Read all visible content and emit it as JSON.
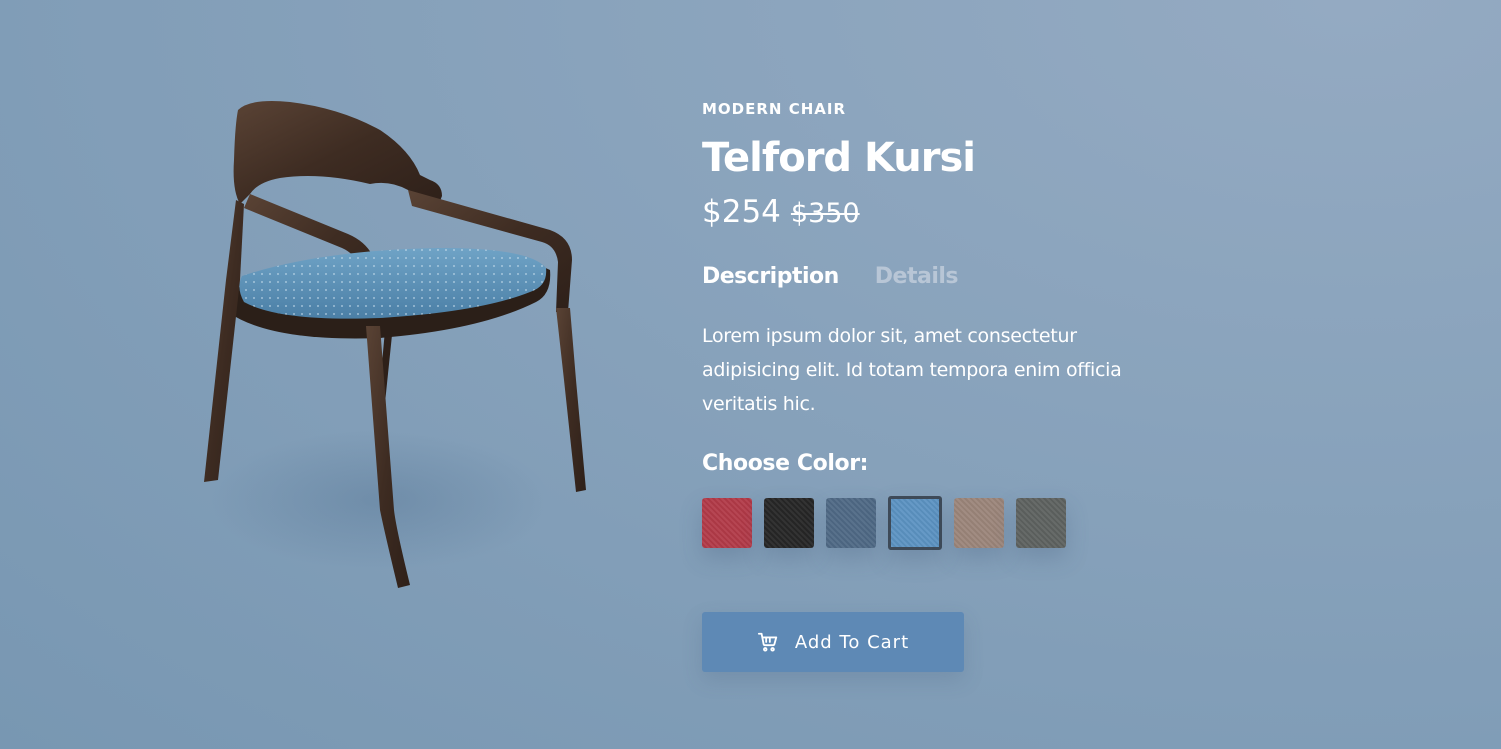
{
  "product": {
    "category": "MODERN CHAIR",
    "name": "Telford Kursi",
    "price_current": "$254",
    "price_old": "$350",
    "image_icon": "chair-image"
  },
  "tabs": [
    {
      "label": "Description",
      "active": true
    },
    {
      "label": "Details",
      "active": false
    }
  ],
  "description": "Lorem ipsum dolor sit, amet consectetur adipisicing elit. Id totam tempora enim officia veritatis hic.",
  "color_picker": {
    "label": "Choose Color:",
    "options": [
      {
        "name": "red",
        "color": "#b23a48"
      },
      {
        "name": "black",
        "color": "#262626"
      },
      {
        "name": "denim",
        "color": "#4f6985"
      },
      {
        "name": "light-blue",
        "color": "#5c93c2",
        "selected": true
      },
      {
        "name": "beige",
        "color": "#9b857a"
      },
      {
        "name": "gray",
        "color": "#5e6260"
      }
    ]
  },
  "cart_button": {
    "label": "Add To Cart",
    "icon": "cart-icon"
  },
  "colors": {
    "accent": "#5e89b5",
    "text": "#ffffff",
    "tab_inactive": "#b8c6d6"
  }
}
